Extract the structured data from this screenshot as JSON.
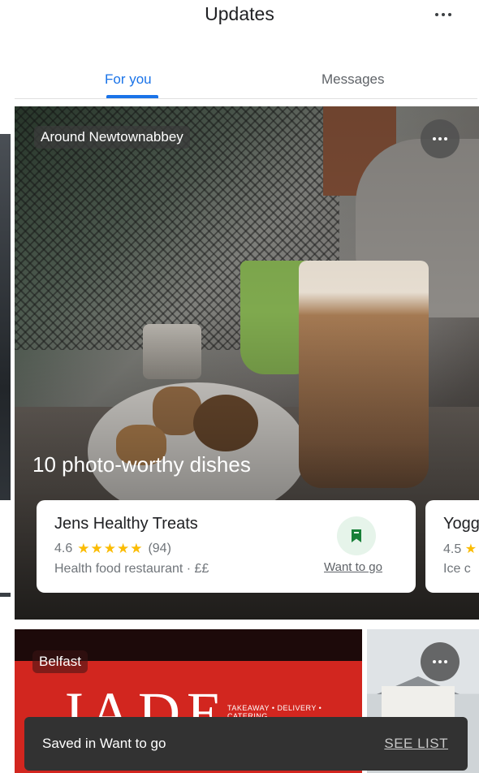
{
  "header": {
    "title": "Updates",
    "more_icon": "more-horizontal-icon"
  },
  "tabs": [
    {
      "label": "For you",
      "active": true
    },
    {
      "label": "Messages",
      "active": false
    }
  ],
  "colors": {
    "accent": "#1a73e8",
    "star": "#fbbc04",
    "save_green": "#188038",
    "snackbar_bg": "#323232"
  },
  "feed": {
    "main_card": {
      "location": "Around Newtownabbey",
      "headline": "10 photo-worthy dishes",
      "more_icon": "more-horizontal-icon",
      "places": [
        {
          "name": "Jens Healthy Treats",
          "rating": "4.6",
          "stars": "★★★★★",
          "reviews": "(94)",
          "category": "Health food restaurant · ££",
          "save_label": "Want to go",
          "save_icon": "bookmark-icon"
        },
        {
          "name": "Yogg",
          "rating": "4.5",
          "category": "Ice c"
        }
      ]
    },
    "second_card": {
      "location": "Belfast",
      "sign_text": "JADE",
      "sign_tagline": "TAKEAWAY • DELIVERY • CATERING"
    }
  },
  "snackbar": {
    "text": "Saved in Want to go",
    "action": "SEE LIST"
  }
}
